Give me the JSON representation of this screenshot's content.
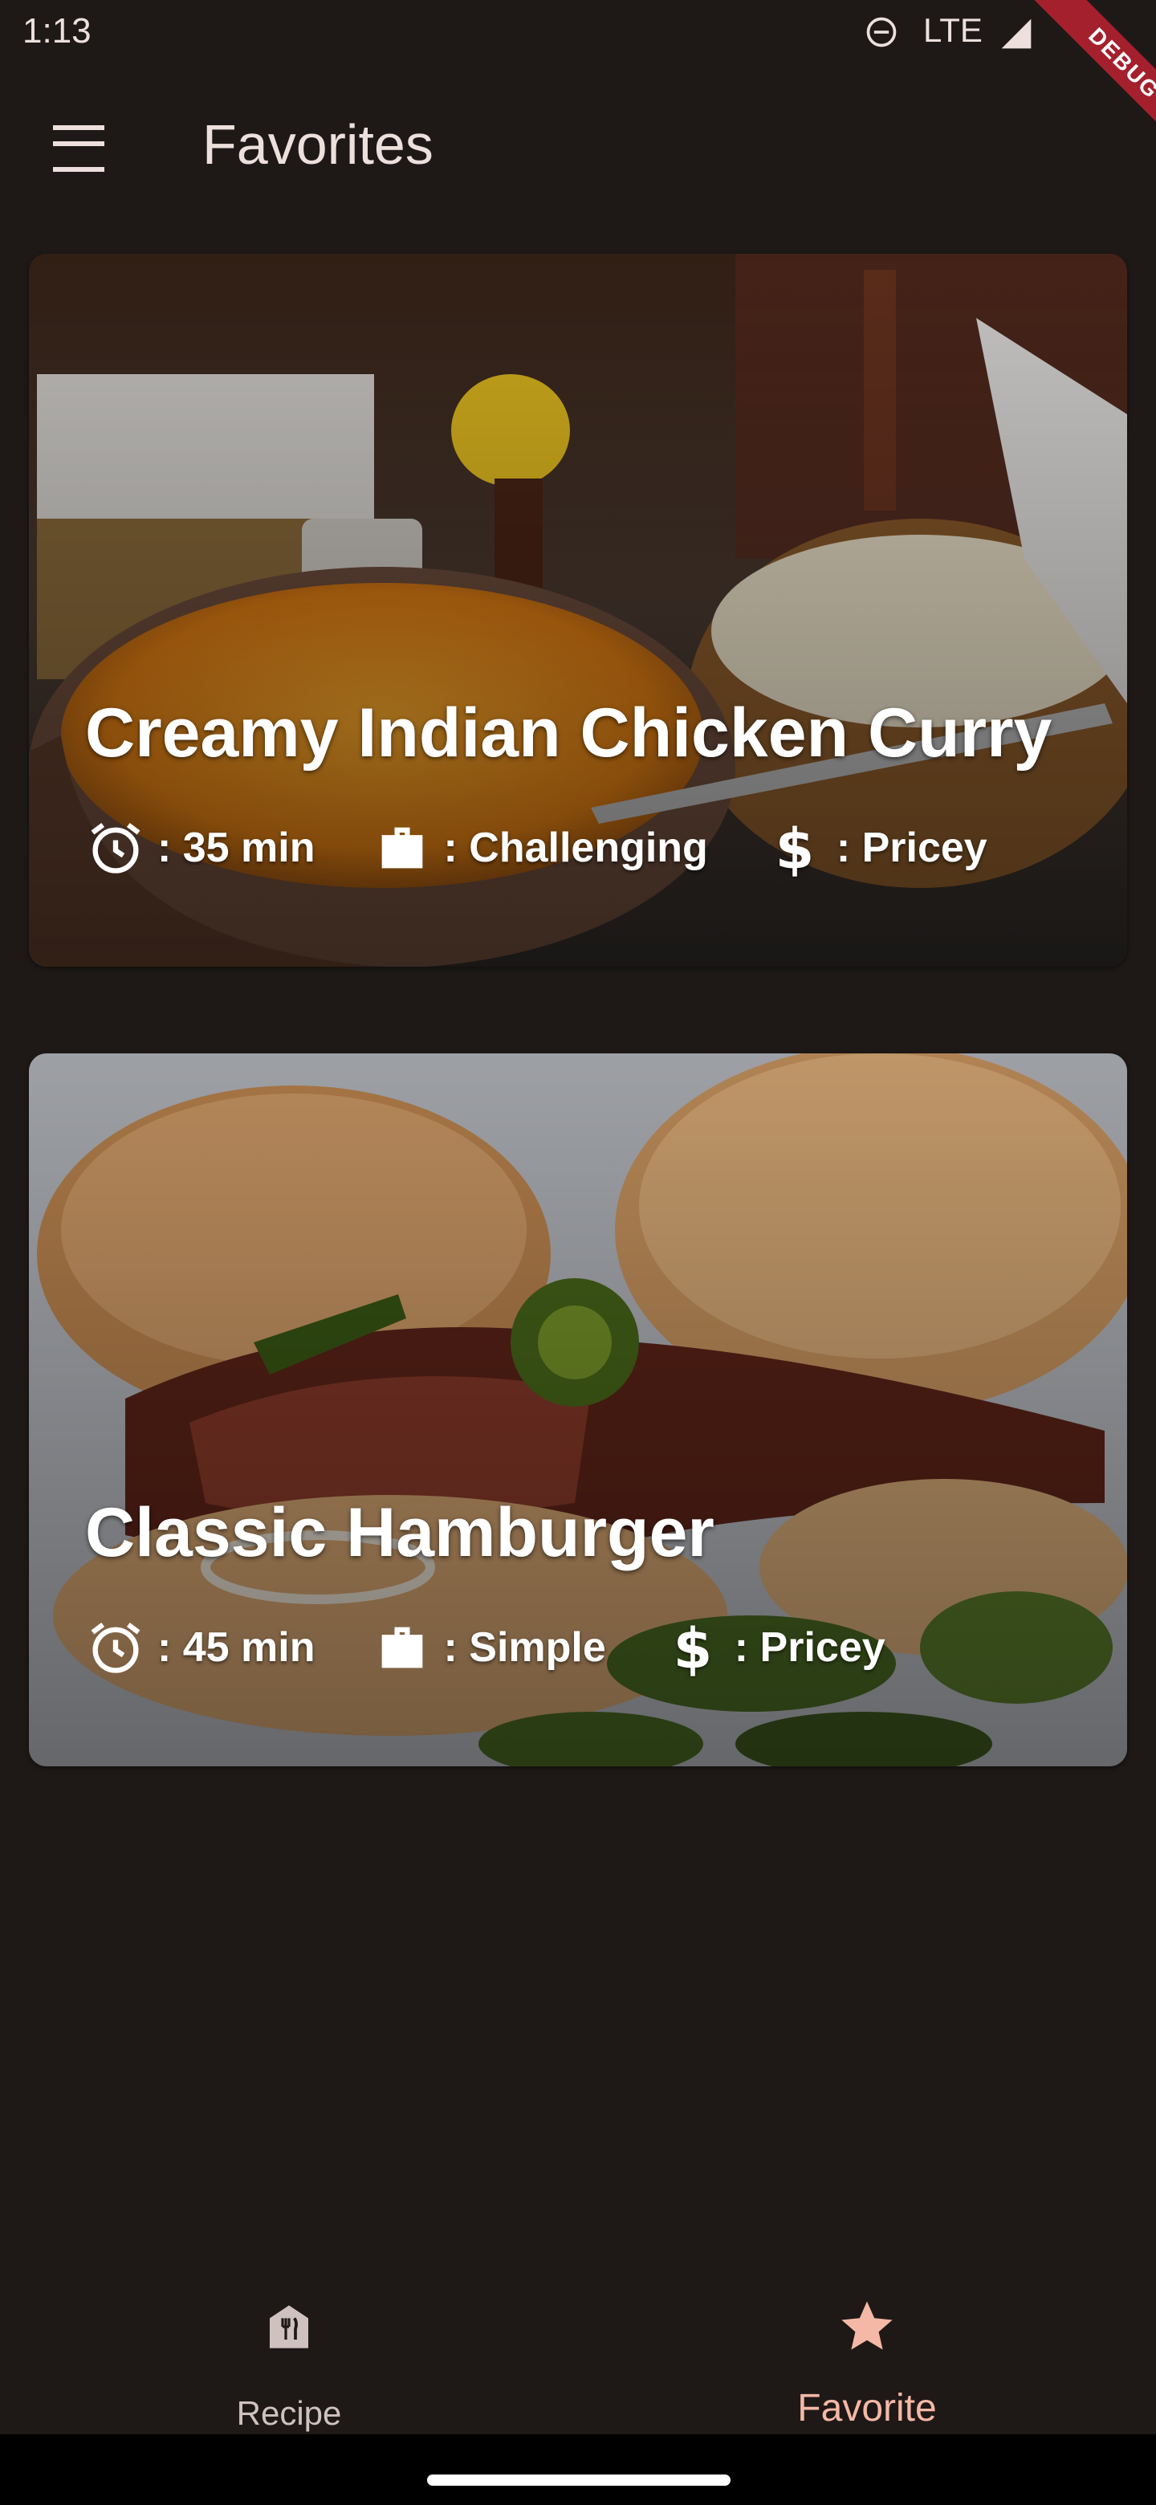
{
  "status_bar": {
    "time": "1:13",
    "network": "LTE",
    "debug_label": "DEBUG"
  },
  "app_bar": {
    "title": "Favorites",
    "menu_icon": "hamburger-menu-icon"
  },
  "meals": [
    {
      "title": "Creamy Indian Chicken Curry",
      "duration": ": 35 min",
      "complexity": ": Challenging",
      "affordability": ": Pricey"
    },
    {
      "title": "Classic Hamburger",
      "duration": ": 45 min",
      "complexity": ": Simple",
      "affordability": ": Pricey"
    }
  ],
  "bottom_nav": {
    "items": [
      {
        "label": "Recipe",
        "icon": "restaurant-icon",
        "selected": false
      },
      {
        "label": "Favorite",
        "icon": "star-icon",
        "selected": true
      }
    ]
  },
  "colors": {
    "background": "#1e1917",
    "text": "#ede0dc",
    "accent": "#f5b8a6",
    "debug_banner": "#a4202d"
  }
}
